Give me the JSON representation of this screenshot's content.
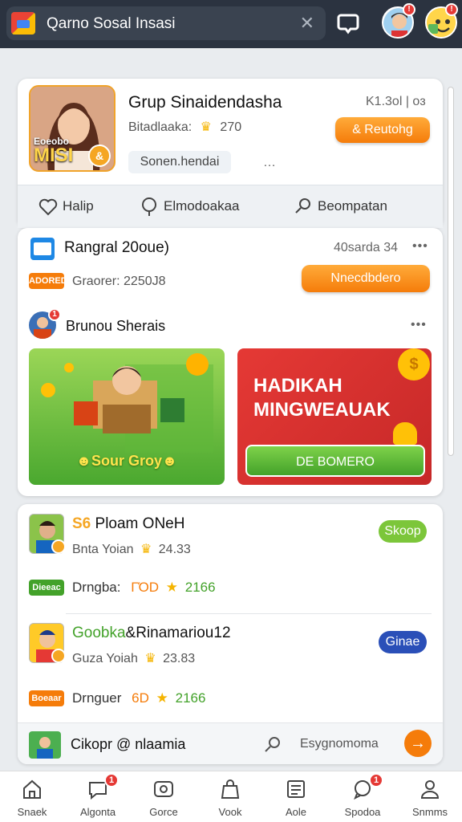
{
  "header": {
    "search_text": "Qarno Sosal Insasi",
    "close_glyph": "✕",
    "avatar_badge_1": "!",
    "avatar_badge_2": "!"
  },
  "group_card": {
    "title": "Grup Sinaidendasha",
    "meta_label": "Bitadlaaka:",
    "meta_value": "270",
    "side_text": "K1.3ol | oɜ",
    "join_button": "& Reutohg",
    "chip": "Sonen.hendai",
    "chip_dots": "…",
    "photo_label_top": "Eoeobo",
    "photo_label_big": "MISI",
    "photo_coin": "&"
  },
  "actions": {
    "items": [
      {
        "label": "Halip",
        "icon": "heart-icon"
      },
      {
        "label": "Elmodoakaa",
        "icon": "comment-icon"
      },
      {
        "label": "Beompatan",
        "icon": "search-icon"
      }
    ]
  },
  "section": {
    "title": "Rangral 20oue)",
    "side_text": "40sarda 34",
    "dots": "•••",
    "tag": "ADORED",
    "sub_label": "Graorer:",
    "sub_value": "2250J8",
    "orange_button": "Nnecdbdero",
    "group_name": "Brunou Sherais",
    "group_badge": "1",
    "group_dots": "•••",
    "green_banner_text": "☻Sour Groy☻",
    "red_banner_line1": "HADIKAH",
    "red_banner_line2": "MINGWEAUAK",
    "red_banner_button": "DE BOMERO",
    "coin_glyph": "$"
  },
  "list": {
    "items": [
      {
        "prefix": "S6",
        "name": "Ploam ONeH",
        "sub_label": "Bnta Yoian",
        "sub_value": "24.33",
        "tag": "Dieeac",
        "detail_label": "Drngba:",
        "detail_value": "ΓΌD",
        "detail_value2": "2166",
        "button": "Skoop",
        "button_color": "#7cc63a"
      },
      {
        "prefix": "Goobka",
        "name": "&Rinamariou12",
        "sub_label": "Guza Yoiah",
        "sub_value": "23.83",
        "tag": "Boeaar",
        "detail_label": "Drnguer",
        "detail_value": "6D",
        "detail_value2": "2166",
        "button": "Ginae",
        "button_color": "#2a4fb8"
      }
    ],
    "footer_name": "Cikopr @ nlaamia",
    "footer_search": "Esygnomoma",
    "footer_arrow": "→"
  },
  "bottom_nav": {
    "items": [
      {
        "label": "Snaek",
        "icon": "home-icon"
      },
      {
        "label": "Algonta",
        "icon": "chat-icon",
        "badge": "1"
      },
      {
        "label": "Gorce",
        "icon": "camera-icon"
      },
      {
        "label": "Vook",
        "icon": "bag-icon"
      },
      {
        "label": "Aole",
        "icon": "list-icon"
      },
      {
        "label": "Spodoa",
        "icon": "bubble-icon",
        "badge": "1"
      },
      {
        "label": "Snmms",
        "icon": "person-icon"
      }
    ]
  },
  "colors": {
    "topbar": "#2b3340",
    "accent_orange": "#f57c0a",
    "accent_green": "#4aa82f",
    "accent_red": "#e53935"
  }
}
